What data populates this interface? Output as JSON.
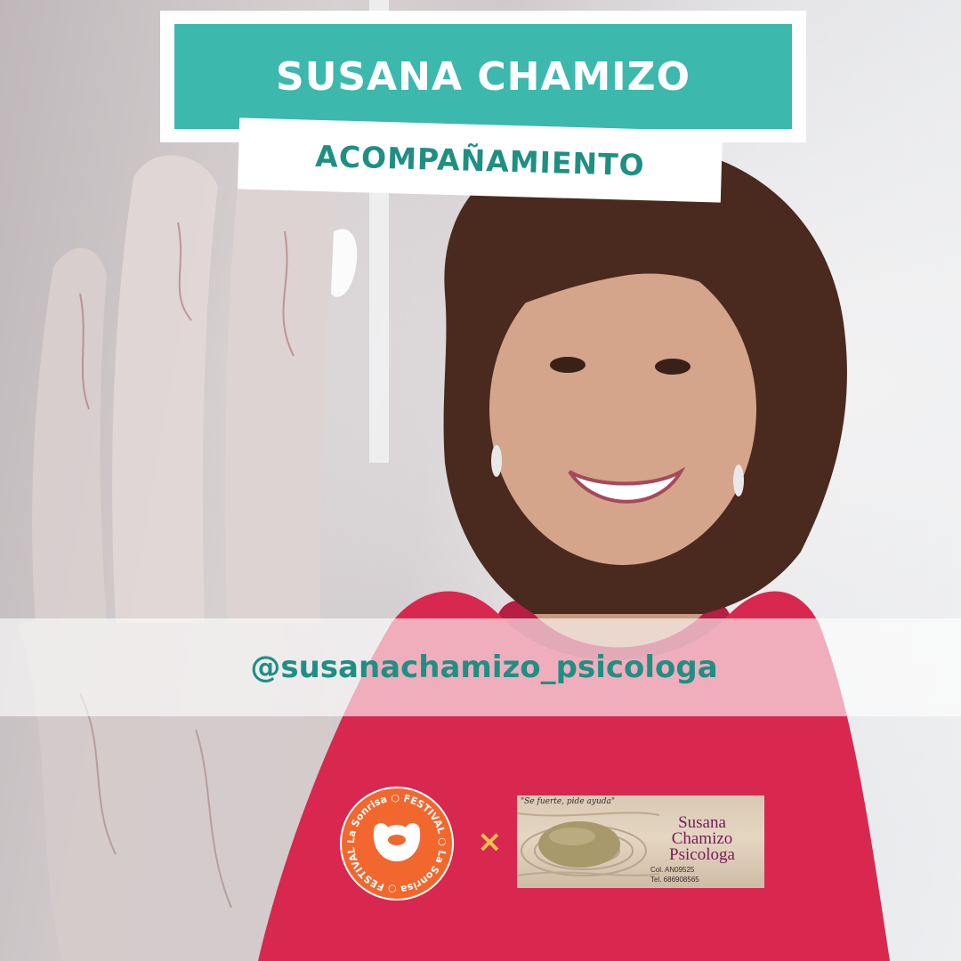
{
  "header": {
    "name": "SUSANA CHAMIZO",
    "role": "ACOMPAÑAMIENTO"
  },
  "social": {
    "handle": "@susanachamizo_psicologa"
  },
  "logos": {
    "festival_badge_text": "La Sonrisa ○ FESTIVAL ○ La Sonrisa ○ FESTIVAL ○",
    "separator": "×",
    "partner": {
      "slogan": "\"Se fuerte, pide ayuda\"",
      "name_line1": "Susana",
      "name_line2": "Chamizo",
      "name_line3": "Psicologa",
      "col": "Col. AN09525",
      "tel": "Tel. 686908565"
    }
  },
  "colors": {
    "teal": "#3cb8ad",
    "teal_text": "#1f8f84",
    "badge_orange": "#f2672e",
    "dress_red": "#d8284f"
  }
}
